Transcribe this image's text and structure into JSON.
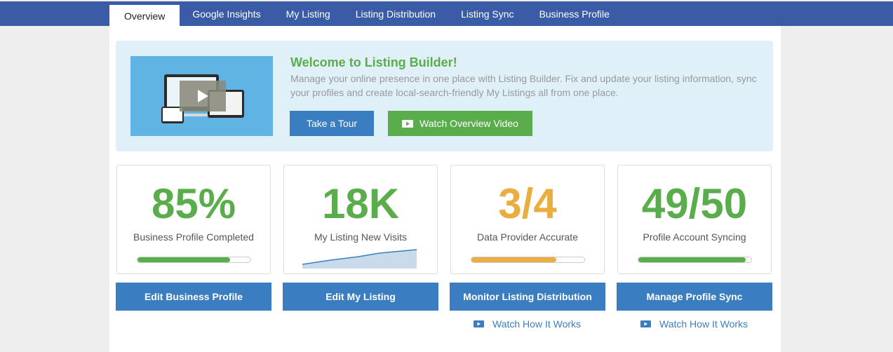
{
  "nav": {
    "tabs": [
      {
        "label": "Overview",
        "active": true
      },
      {
        "label": "Google Insights"
      },
      {
        "label": "My Listing"
      },
      {
        "label": "Listing Distribution"
      },
      {
        "label": "Listing Sync"
      },
      {
        "label": "Business Profile"
      }
    ]
  },
  "welcome": {
    "title": "Welcome to Listing Builder!",
    "description": "Manage your online presence in one place with Listing Builder. Fix and update your listing information, sync your profiles and create local-search-friendly My Listings all from one place.",
    "tour_label": "Take a Tour",
    "video_label": "Watch Overview Video"
  },
  "cards": [
    {
      "value": "85%",
      "label": "Business Profile Completed",
      "color": "#5aad4b",
      "progress": 0.82,
      "bar_color": "#5aad4b",
      "action": "Edit Business Profile"
    },
    {
      "value": "18K",
      "label": "My Listing New Visits",
      "color": "#5aad4b",
      "action": "Edit My Listing"
    },
    {
      "value": "3/4",
      "label": "Data Provider Accurate",
      "color": "#e9ae3f",
      "progress": 0.75,
      "bar_color": "#e9ae3f",
      "action": "Monitor Listing Distribution",
      "link": "Watch How It Works"
    },
    {
      "value": "49/50",
      "label": "Profile Account Syncing",
      "color": "#5aad4b",
      "progress": 0.95,
      "bar_color": "#5aad4b",
      "action": "Manage Profile Sync",
      "link": "Watch How It Works"
    }
  ],
  "colors": {
    "nav_bg": "#3a5ca7",
    "accent_blue": "#3a7dc0",
    "accent_green": "#5aad4b",
    "accent_orange": "#e9ae3f"
  }
}
